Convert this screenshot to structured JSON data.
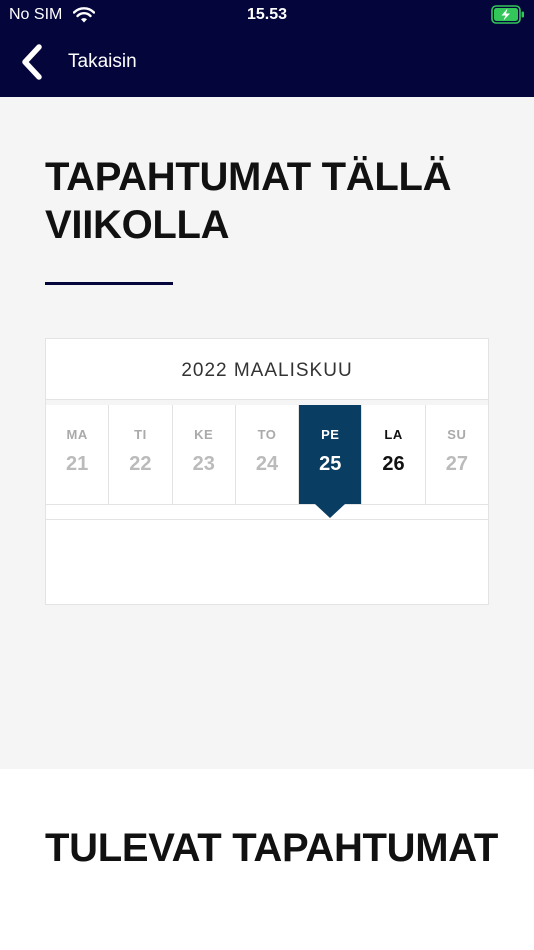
{
  "status_bar": {
    "carrier": "No SIM",
    "time": "15.53",
    "icons": [
      "wifi-icon",
      "battery-charging-icon"
    ],
    "battery_color": "#33c759"
  },
  "nav": {
    "back_label": "Takaisin",
    "icon": "chevron-left-icon",
    "background": "#03053b"
  },
  "week_section": {
    "title": "TAPAHTUMAT TÄLLÄ VIIKOLLA",
    "calendar": {
      "month_label": "2022 MAALISKUU",
      "selected_day": "25",
      "selected_color": "#0a3d62",
      "days": [
        {
          "name": "MA",
          "num": "21"
        },
        {
          "name": "TI",
          "num": "22"
        },
        {
          "name": "KE",
          "num": "23"
        },
        {
          "name": "TO",
          "num": "24"
        },
        {
          "name": "PE",
          "num": "25"
        },
        {
          "name": "LA",
          "num": "26"
        },
        {
          "name": "SU",
          "num": "27"
        }
      ]
    }
  },
  "upcoming_section": {
    "title": "TULEVAT TAPAHTUMAT"
  }
}
